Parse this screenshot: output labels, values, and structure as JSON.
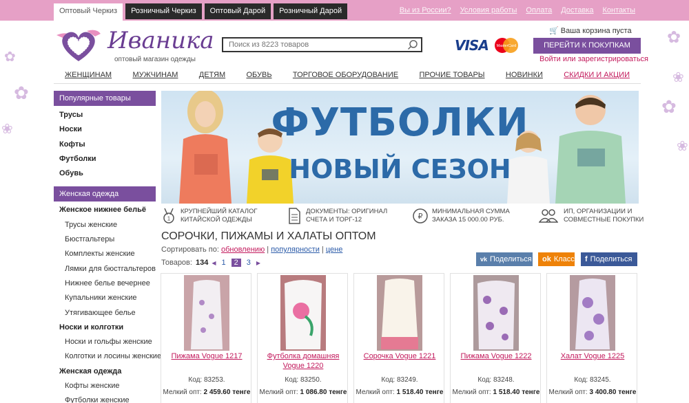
{
  "top_tabs": [
    {
      "label": "Оптовый Черкиз",
      "active": true
    },
    {
      "label": "Розничный Черкиз",
      "active": false
    },
    {
      "label": "Оптовый Дарой",
      "active": false
    },
    {
      "label": "Розничный Дарой",
      "active": false
    }
  ],
  "top_links": [
    "Вы из России?",
    "Условия работы",
    "Оплата",
    "Доставка",
    "Контакты"
  ],
  "logo": {
    "title": "Иваника",
    "subtitle": "оптовый магазин одежды"
  },
  "search": {
    "placeholder": "Поиск из 8223 товаров"
  },
  "payment": {
    "visa": "VISA",
    "mastercard": "MasterCard"
  },
  "cart": {
    "label": "Ваша корзина пуста",
    "buy_button": "ПЕРЕЙТИ К ПОКУПКАМ",
    "login": "Войти или зарегистрироваться"
  },
  "main_nav": [
    "ЖЕНЩИНАМ",
    "МУЖЧИНАМ",
    "ДЕТЯМ",
    "ОБУВЬ",
    "ТОРГОВОЕ ОБОРУДОВАНИЕ",
    "ПРОЧИЕ ТОВАРЫ",
    "НОВИНКИ",
    "СКИДКИ И АКЦИИ"
  ],
  "sidebar": {
    "popular_head": "Популярные товары",
    "popular": [
      "Трусы",
      "Носки",
      "Кофты",
      "Футболки",
      "Обувь"
    ],
    "women_head": "Женская одежда",
    "groups": [
      {
        "title": "Женское нижнее бельё",
        "items": [
          "Трусы женские",
          "Бюстгальтеры",
          "Комплекты женские",
          "Лямки для бюстгальтеров",
          "Нижнее белье вечернее",
          "Купальники женские",
          "Утягивающее белье"
        ]
      },
      {
        "title": "Носки и колготки",
        "items": [
          "Носки и гольфы женские",
          "Колготки и лосины женские"
        ]
      },
      {
        "title": "Женская одежда",
        "items": [
          "Кофты женские",
          "Футболки женские"
        ]
      }
    ]
  },
  "banner": {
    "line1": "ФУТБОЛКИ",
    "line2": "НОВЫЙ СЕЗОН"
  },
  "features": [
    {
      "icon": "medal-icon",
      "line1": "Крупнейший каталог",
      "line2": "китайской одежды"
    },
    {
      "icon": "document-icon",
      "line1": "Документы: оригинал",
      "line2": "счета и торг-12"
    },
    {
      "icon": "ruble-icon",
      "line1": "Минимальная сумма",
      "line2": "заказа 15 000.00 руб."
    },
    {
      "icon": "people-icon",
      "line1": "ИП, организации и",
      "line2": "совместные покупки"
    }
  ],
  "catalog": {
    "title": "СОРОЧКИ, ПИЖАМЫ И ХАЛАТЫ ОПТОМ",
    "sort_label": "Сортировать по:",
    "sort_options": [
      "обновлению",
      "популярности",
      "цене"
    ],
    "count_label": "Товаров:",
    "count": "134",
    "pages": [
      "1",
      "2",
      "3"
    ],
    "current_page": "2"
  },
  "share": {
    "vk": "Поделиться",
    "ok": "Класс",
    "fb": "Поделиться"
  },
  "products": [
    {
      "name": "Пижама Vogue 1217",
      "code_label": "Код:",
      "code": "83253",
      "price_label": "Мелкий опт:",
      "price": "2 459.60 тенге"
    },
    {
      "name": "Футболка домашняя Vogue 1220",
      "code_label": "Код:",
      "code": "83250",
      "price_label": "Мелкий опт:",
      "price": "1 086.80 тенге"
    },
    {
      "name": "Сорочка Vogue 1221",
      "code_label": "Код:",
      "code": "83249",
      "price_label": "Мелкий опт:",
      "price": "1 518.40 тенге"
    },
    {
      "name": "Пижама Vogue 1222",
      "code_label": "Код:",
      "code": "83248",
      "price_label": "Мелкий опт:",
      "price": "1 518.40 тенге"
    },
    {
      "name": "Халат Vogue 1225",
      "code_label": "Код:",
      "code": "83245",
      "price_label": "Мелкий опт:",
      "price": "3 400.80 тенге"
    }
  ],
  "colors": {
    "top_bar": "#e6a0c6",
    "accent_purple": "#7a4f9e",
    "link_pink": "#c2185b",
    "banner_text": "#2c6aa8"
  }
}
